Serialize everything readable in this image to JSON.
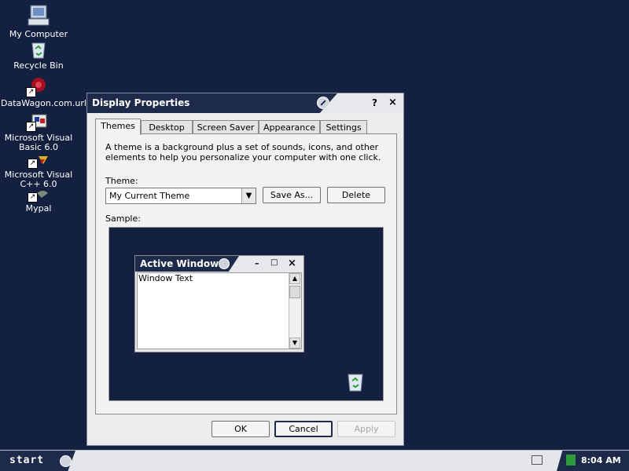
{
  "desktop": {
    "icons": [
      {
        "label": "My Computer",
        "icon": "my-computer-icon"
      },
      {
        "label": "Recycle Bin",
        "icon": "recycle-bin-icon"
      },
      {
        "label": "DataWagon.com.url",
        "icon": "internet-shortcut-icon"
      },
      {
        "label": "Microsoft Visual Basic 6.0",
        "icon": "visual-basic-icon"
      },
      {
        "label": "Microsoft Visual C++ 6.0",
        "icon": "visual-cpp-icon"
      },
      {
        "label": "Mypal",
        "icon": "mypal-browser-icon"
      }
    ]
  },
  "dialog": {
    "title": "Display Properties",
    "help": "?",
    "close": "×",
    "tabs": [
      "Themes",
      "Desktop",
      "Screen Saver",
      "Appearance",
      "Settings"
    ],
    "active_tab": "Themes",
    "description": "A theme is a background plus a set of sounds, icons, and other elements to help you personalize your computer with one click.",
    "theme_label": "Theme:",
    "theme_value": "My Current Theme",
    "save_as": "Save As...",
    "delete": "Delete",
    "sample_label": "Sample:",
    "sample": {
      "title": "Active Window",
      "text": "Window Text",
      "min": "–",
      "max": "□",
      "close": "×"
    },
    "ok": "OK",
    "cancel": "Cancel",
    "apply": "Apply"
  },
  "taskbar": {
    "start": "start",
    "clock": "8:04 AM"
  },
  "colors": {
    "desktop_bg": "#13203f",
    "titlebar": "#1d2a4a",
    "dialog_bg": "#ececec"
  }
}
